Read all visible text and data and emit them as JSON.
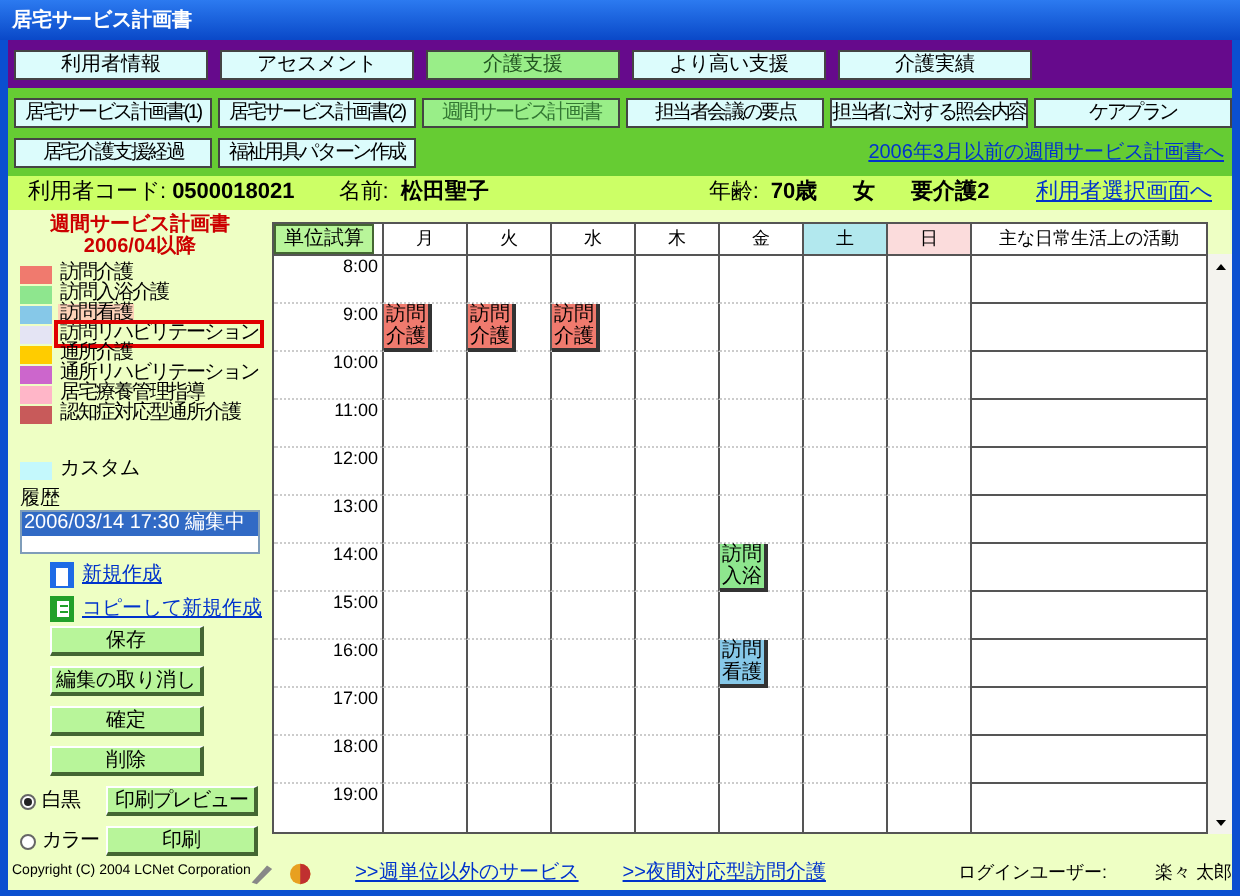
{
  "window": {
    "title": "居宅サービス計画書"
  },
  "main_tabs": [
    {
      "label": "利用者情報",
      "selected": false
    },
    {
      "label": "アセスメント",
      "selected": false
    },
    {
      "label": "介護支援",
      "selected": true
    },
    {
      "label": "より高い支援",
      "selected": false
    },
    {
      "label": "介護実績",
      "selected": false
    }
  ],
  "sub_tabs": [
    {
      "label": "居宅サービス計画書(1)",
      "selected": false
    },
    {
      "label": "居宅サービス計画書(2)",
      "selected": false
    },
    {
      "label": "週間サービス計画書",
      "selected": true
    },
    {
      "label": "担当者会議の要点",
      "selected": false
    },
    {
      "label": "担当者に対する照会内容",
      "selected": false
    },
    {
      "label": "ケアプラン",
      "selected": false
    },
    {
      "label": "居宅介護支援経過",
      "selected": false
    },
    {
      "label": "福祉用具パターン作成",
      "selected": false
    }
  ],
  "old_plan_link": "2006年3月以前の週間サービス計画書へ",
  "user_info": {
    "code_label": "利用者コード:",
    "code": "0500018021",
    "name_label": "名前:",
    "name": "松田聖子",
    "age_label": "年齢:",
    "age": "70歳",
    "sex": "女",
    "care_level": "要介護2",
    "select_link": "利用者選択画面へ"
  },
  "sidebar": {
    "title": "週間サービス計画書",
    "subtitle": "2006/04以降",
    "legend": [
      {
        "label": "訪問介護",
        "color": "#f07a6e",
        "selected": false,
        "highlighted": false
      },
      {
        "label": "訪問入浴介護",
        "color": "#8ee68e",
        "selected": false,
        "highlighted": false
      },
      {
        "label": "訪問看護",
        "color": "#86c8e8",
        "selected": false,
        "highlighted": true
      },
      {
        "label": "訪問リハビリテーション",
        "color": "#e4e4f4",
        "selected": true,
        "highlighted": false
      },
      {
        "label": "通所介護",
        "color": "#ffcc00",
        "selected": false,
        "highlighted": false
      },
      {
        "label": "通所リハビリテーション",
        "color": "#cc66cc",
        "selected": false,
        "highlighted": false
      },
      {
        "label": "居宅療養管理指導",
        "color": "#ffb6c8",
        "selected": false,
        "highlighted": false
      },
      {
        "label": "認知症対応型通所介護",
        "color": "#c85a5a",
        "selected": false,
        "highlighted": false
      }
    ],
    "custom": {
      "label": "カスタム",
      "color": "#c4f8fc"
    },
    "history_label": "履歴",
    "history": [
      {
        "label": "2006/03/14 17:30 編集中",
        "selected": true
      }
    ],
    "new_link": "新規作成",
    "copy_link": "コピーして新規作成",
    "buttons": [
      "保存",
      "編集の取り消し",
      "確定",
      "削除"
    ],
    "print_options": [
      {
        "label": "白黒",
        "selected": true,
        "button": "印刷プレビュー"
      },
      {
        "label": "カラー",
        "selected": false,
        "button": "印刷"
      }
    ]
  },
  "schedule": {
    "calc_button": "単位試算",
    "days": [
      {
        "label": "月",
        "color": "#ffffff"
      },
      {
        "label": "火",
        "color": "#ffffff"
      },
      {
        "label": "水",
        "color": "#ffffff"
      },
      {
        "label": "木",
        "color": "#ffffff"
      },
      {
        "label": "金",
        "color": "#ffffff"
      },
      {
        "label": "土",
        "color": "#b2e8ee"
      },
      {
        "label": "日",
        "color": "#fbdcdc"
      }
    ],
    "activity_header": "主な日常生活上の活動",
    "rows": [
      {
        "time": "8:00",
        "cells": [
          null,
          null,
          null,
          null,
          null,
          null,
          null
        ]
      },
      {
        "time": "9:00",
        "cells": [
          {
            "text": "訪問介護",
            "color": "#f07a6e"
          },
          {
            "text": "訪問介護",
            "color": "#f07a6e"
          },
          {
            "text": "訪問介護",
            "color": "#f07a6e"
          },
          null,
          null,
          null,
          null
        ]
      },
      {
        "time": "10:00",
        "cells": [
          null,
          null,
          null,
          null,
          null,
          null,
          null
        ]
      },
      {
        "time": "11:00",
        "cells": [
          null,
          null,
          null,
          null,
          null,
          null,
          null
        ]
      },
      {
        "time": "12:00",
        "cells": [
          null,
          null,
          null,
          null,
          null,
          null,
          null
        ]
      },
      {
        "time": "13:00",
        "cells": [
          null,
          null,
          null,
          null,
          null,
          null,
          null
        ]
      },
      {
        "time": "14:00",
        "cells": [
          null,
          null,
          null,
          null,
          {
            "text": "訪問入浴",
            "color": "#8ee68e"
          },
          null,
          null
        ]
      },
      {
        "time": "15:00",
        "cells": [
          null,
          null,
          null,
          null,
          null,
          null,
          null
        ]
      },
      {
        "time": "16:00",
        "cells": [
          null,
          null,
          null,
          null,
          {
            "text": "訪問看護",
            "color": "#86c8e8"
          },
          null,
          null
        ]
      },
      {
        "time": "17:00",
        "cells": [
          null,
          null,
          null,
          null,
          null,
          null,
          null
        ]
      },
      {
        "time": "18:00",
        "cells": [
          null,
          null,
          null,
          null,
          null,
          null,
          null
        ]
      },
      {
        "time": "19:00",
        "cells": [
          null,
          null,
          null,
          null,
          null,
          null,
          null
        ]
      }
    ]
  },
  "footer": {
    "copyright": "Copyright (C) 2004 LCNet Corporation",
    "links": [
      ">>週単位以外のサービス",
      ">>夜間対応型訪問介護"
    ],
    "login_label": "ログインユーザー:",
    "login_user": "楽々 太郎"
  }
}
